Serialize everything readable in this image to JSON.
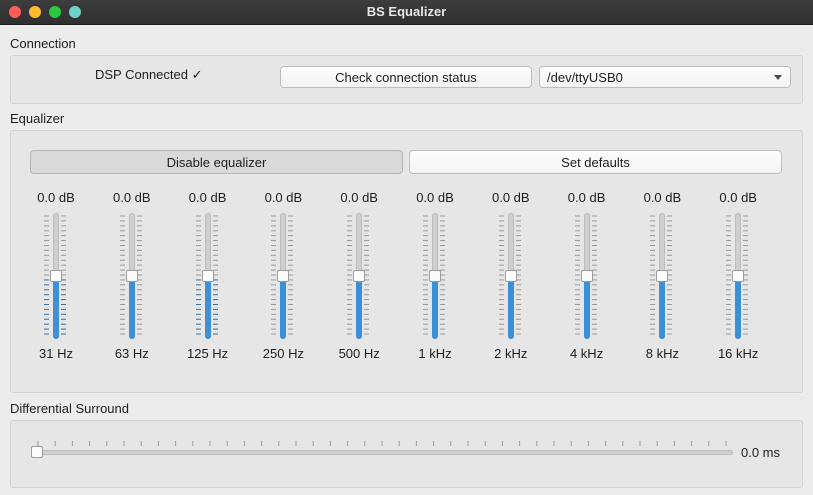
{
  "window": {
    "title": "BS Equalizer",
    "controls": [
      "close-icon",
      "minimize-icon",
      "maximize-icon",
      "extra-icon"
    ]
  },
  "connection": {
    "label": "Connection",
    "status": "DSP Connected ✓",
    "check_button": "Check connection status",
    "port_selected": "/dev/ttyUSB0"
  },
  "equalizer": {
    "label": "Equalizer",
    "disable_button": "Disable equalizer",
    "defaults_button": "Set defaults",
    "range_db": [
      -12,
      12
    ],
    "bands": [
      {
        "freq": "31 Hz",
        "gain": "0.0 dB",
        "value": 0
      },
      {
        "freq": "63 Hz",
        "gain": "0.0 dB",
        "value": 0
      },
      {
        "freq": "125 Hz",
        "gain": "0.0 dB",
        "value": 0
      },
      {
        "freq": "250 Hz",
        "gain": "0.0 dB",
        "value": 0
      },
      {
        "freq": "500 Hz",
        "gain": "0.0 dB",
        "value": 0
      },
      {
        "freq": "1 kHz",
        "gain": "0.0 dB",
        "value": 0
      },
      {
        "freq": "2 kHz",
        "gain": "0.0 dB",
        "value": 0
      },
      {
        "freq": "4 kHz",
        "gain": "0.0 dB",
        "value": 0
      },
      {
        "freq": "8 kHz",
        "gain": "0.0 dB",
        "value": 0
      },
      {
        "freq": "16 kHz",
        "gain": "0.0 dB",
        "value": 0
      }
    ]
  },
  "surround": {
    "label": "Differential Surround",
    "value_label": "0.0 ms",
    "value_fraction": 0
  },
  "colors": {
    "accent": "#3d8fd6",
    "tick_active": "#3a6f98"
  }
}
